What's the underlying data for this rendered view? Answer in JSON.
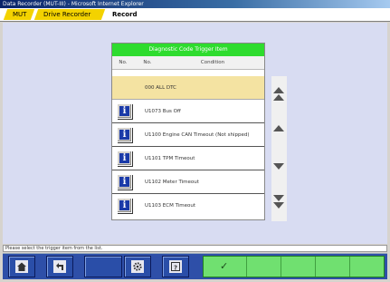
{
  "window": {
    "title": "Data Recorder (MUT-III) - Microsoft Internet Explorer"
  },
  "tabs": [
    {
      "label": "MUT"
    },
    {
      "label": "Drive Recorder"
    },
    {
      "label": "Record"
    }
  ],
  "panel": {
    "header": "Diagnostic Code Trigger Item",
    "columns": [
      "No.",
      "No.",
      "Condition"
    ],
    "rows": [
      {
        "code": "000  ALL DTC",
        "selected": true,
        "has_info": false
      },
      {
        "code": "U1073  Bus Off",
        "selected": false,
        "has_info": true
      },
      {
        "code": "U1100  Engine CAN Timeout (Not shipped)",
        "selected": false,
        "has_info": true
      },
      {
        "code": "U1101  TPM Timeout",
        "selected": false,
        "has_info": true
      },
      {
        "code": "U1102  Meter Timeout",
        "selected": false,
        "has_info": true
      },
      {
        "code": "U1103  ECM Timeout",
        "selected": false,
        "has_info": true
      }
    ]
  },
  "status": {
    "text": "Please select the trigger item from the list."
  },
  "toolbar": {
    "buttons": [
      {
        "icon": "home-icon"
      },
      {
        "icon": "back-arrow-icon"
      },
      {
        "icon": "gear-icon"
      },
      {
        "icon": "help-icon",
        "glyph": "?"
      }
    ],
    "ok_glyph": "✓"
  },
  "colors": {
    "accent_green": "#2edc2e",
    "tab_yellow": "#f3d200",
    "toolbar_blue": "#2e4fa8",
    "selected_row": "#f4e3a2"
  }
}
